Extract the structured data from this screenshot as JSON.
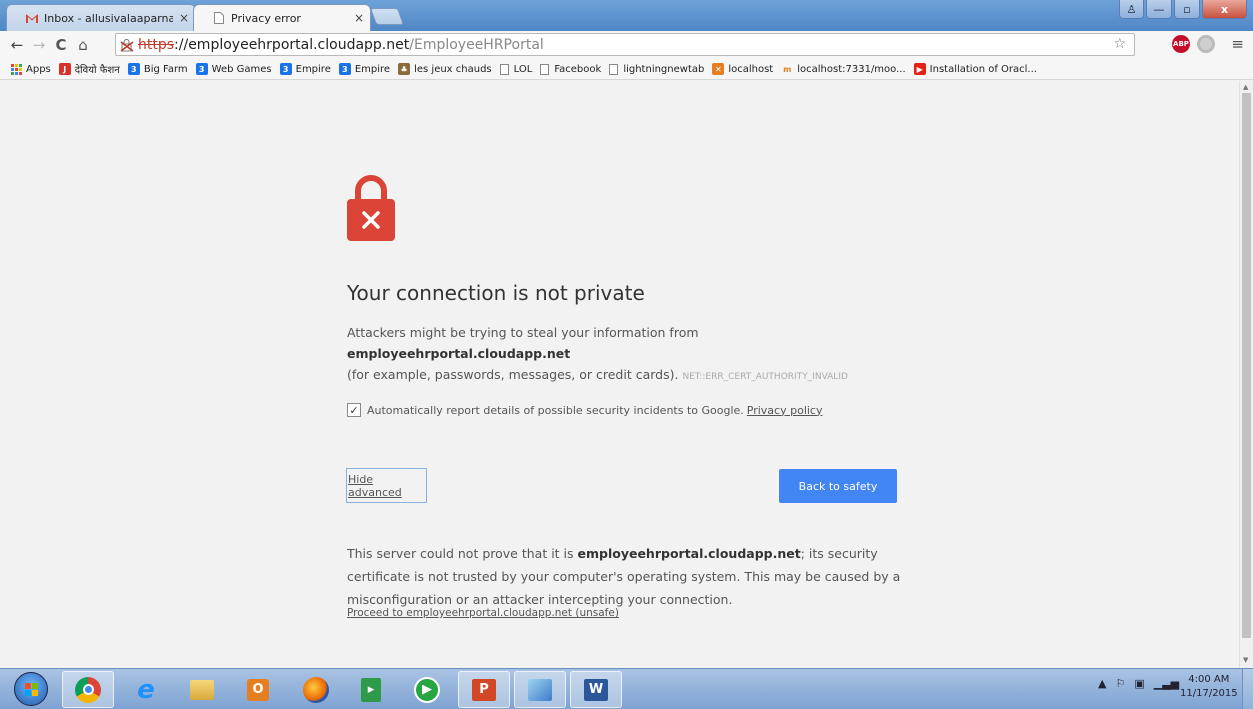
{
  "tabs": [
    {
      "title": "Inbox - allusivalaaparna@",
      "close": "×"
    },
    {
      "title": "Privacy error",
      "close": "×"
    }
  ],
  "window_controls": {
    "user": "♙",
    "minimize": "—",
    "maximize": "▫",
    "close": "x"
  },
  "toolbar": {
    "back": "←",
    "forward": "→",
    "reload": "C",
    "home": "⌂",
    "url_scheme": "https",
    "url_host": "://employeehrportal.cloudapp.net",
    "url_path": "/EmployeeHRPortal",
    "star": "☆",
    "abp_label": "ABP",
    "menu": "≡"
  },
  "bookmarks": [
    {
      "label": "Apps",
      "icon": "apps-icon",
      "color": "#4285f4"
    },
    {
      "label": "देवियो फैशन",
      "icon": "fashion-icon",
      "color": "#d93025"
    },
    {
      "label": "Big Farm",
      "icon": "game-icon",
      "color": "#1a73e8"
    },
    {
      "label": "Web Games",
      "icon": "game-icon",
      "color": "#1a73e8"
    },
    {
      "label": "Empire",
      "icon": "game-icon",
      "color": "#1a73e8"
    },
    {
      "label": "Empire",
      "icon": "game-icon",
      "color": "#1a73e8"
    },
    {
      "label": "les jeux chauds",
      "icon": "person-icon",
      "color": "#8a6d3b"
    },
    {
      "label": "LOL",
      "icon": "page-icon",
      "color": "#888888"
    },
    {
      "label": "Facebook",
      "icon": "page-icon",
      "color": "#888888"
    },
    {
      "label": "lightningnewtab",
      "icon": "page-icon",
      "color": "#888888"
    },
    {
      "label": "localhost",
      "icon": "xampp-icon",
      "color": "#e67e22"
    },
    {
      "label": "localhost:7331/moo...",
      "icon": "moodle-icon",
      "color": "#e67e22"
    },
    {
      "label": "Installation of Oracl...",
      "icon": "youtube-icon",
      "color": "#e62117"
    }
  ],
  "page": {
    "heading": "Your connection is not private",
    "para_line1_prefix": "Attackers might be trying to steal your information from ",
    "para_host": "employeehrportal.cloudapp.net",
    "para_line2": "(for example, passwords, messages, or credit cards).",
    "error_code": "NET::ERR_CERT_AUTHORITY_INVALID",
    "report_text": "Automatically report details of possible security incidents to Google.",
    "privacy_link": "Privacy policy",
    "report_checked": true,
    "hide_advanced": "Hide advanced",
    "back_to_safety": "Back to safety",
    "adv_prefix": "This server could not prove that it is ",
    "adv_host": "employeehrportal.cloudapp.net",
    "adv_suffix": "; its security certificate is not trusted by your computer's operating system. This may be caused by a misconfiguration or an attacker intercepting your connection.",
    "proceed_link": "Proceed to employeehrportal.cloudapp.net (unsafe)"
  },
  "taskbar": {
    "apps": [
      {
        "name": "chrome-icon",
        "active": true
      },
      {
        "name": "internet-explorer-icon",
        "active": false
      },
      {
        "name": "file-explorer-icon",
        "active": false
      },
      {
        "name": "outlook-icon",
        "active": false
      },
      {
        "name": "firefox-icon",
        "active": false
      },
      {
        "name": "camtasia-icon",
        "active": false
      },
      {
        "name": "media-player-icon",
        "active": false
      },
      {
        "name": "powerpoint-icon",
        "active": true
      },
      {
        "name": "virtual-pc-icon",
        "active": true
      },
      {
        "name": "word-icon",
        "active": true
      }
    ],
    "time": "4:00 AM",
    "date": "11/17/2015"
  },
  "colors": {
    "lock_red": "#db4437",
    "button_blue": "#4285f4",
    "page_bg": "#f2f2f2"
  }
}
